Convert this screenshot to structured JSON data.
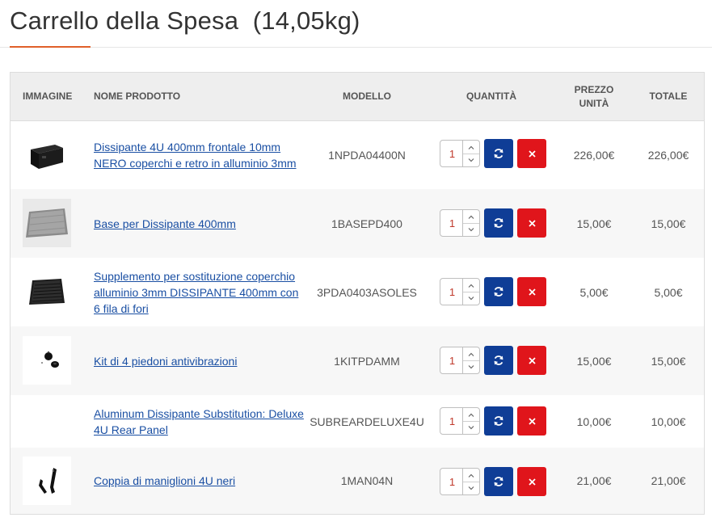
{
  "page": {
    "title": "Carrello della Spesa  (14,05kg)"
  },
  "table": {
    "headers": {
      "image": "IMMAGINE",
      "name": "NOME PRODOTTO",
      "model": "MODELLO",
      "quantity": "QUANTITÀ",
      "unit_price": "PREZZO UNITÀ",
      "total": "TOTALE"
    },
    "rows": [
      {
        "image_icon": "rack-cabinet-black",
        "name": "Dissipante 4U 400mm frontale 10mm NERO coperchi e retro in alluminio 3mm",
        "model": "1NPDA04400N",
        "quantity": "1",
        "unit_price": "226,00€",
        "total": "226,00€"
      },
      {
        "image_icon": "aluminium-base-plate",
        "name": "Base per Dissipante 400mm",
        "model": "1BASEPD400",
        "quantity": "1",
        "unit_price": "15,00€",
        "total": "15,00€"
      },
      {
        "image_icon": "perforated-cover-plate",
        "name": "Supplemento per sostituzione coperchio alluminio 3mm DISSIPANTE 400mm con 6 fila di fori",
        "model": "3PDA0403ASOLES",
        "quantity": "1",
        "unit_price": "5,00€",
        "total": "5,00€"
      },
      {
        "image_icon": "anti-vibration-feet",
        "name": "Kit di 4 piedoni antivibrazioni",
        "model": "1KITPDAMM",
        "quantity": "1",
        "unit_price": "15,00€",
        "total": "15,00€"
      },
      {
        "image_icon": "",
        "name": "Aluminum Dissipante Substitution: Deluxe 4U Rear Panel",
        "model": "SUBREARDELUXE4U",
        "quantity": "1",
        "unit_price": "10,00€",
        "total": "10,00€"
      },
      {
        "image_icon": "black-rack-handles",
        "name": "Coppia di maniglioni 4U neri",
        "model": "1MAN04N",
        "quantity": "1",
        "unit_price": "21,00€",
        "total": "21,00€"
      }
    ]
  },
  "icons": {
    "update": "refresh-icon",
    "remove": "close-icon",
    "increment": "chevron-up-icon",
    "decrement": "chevron-down-icon"
  },
  "colors": {
    "accent_underline": "#e0602a",
    "link": "#1a4fa3",
    "update_button": "#0f3d96",
    "remove_button": "#e0151b",
    "header_background": "#eeeeee",
    "alternate_row": "#f7f7f7"
  }
}
